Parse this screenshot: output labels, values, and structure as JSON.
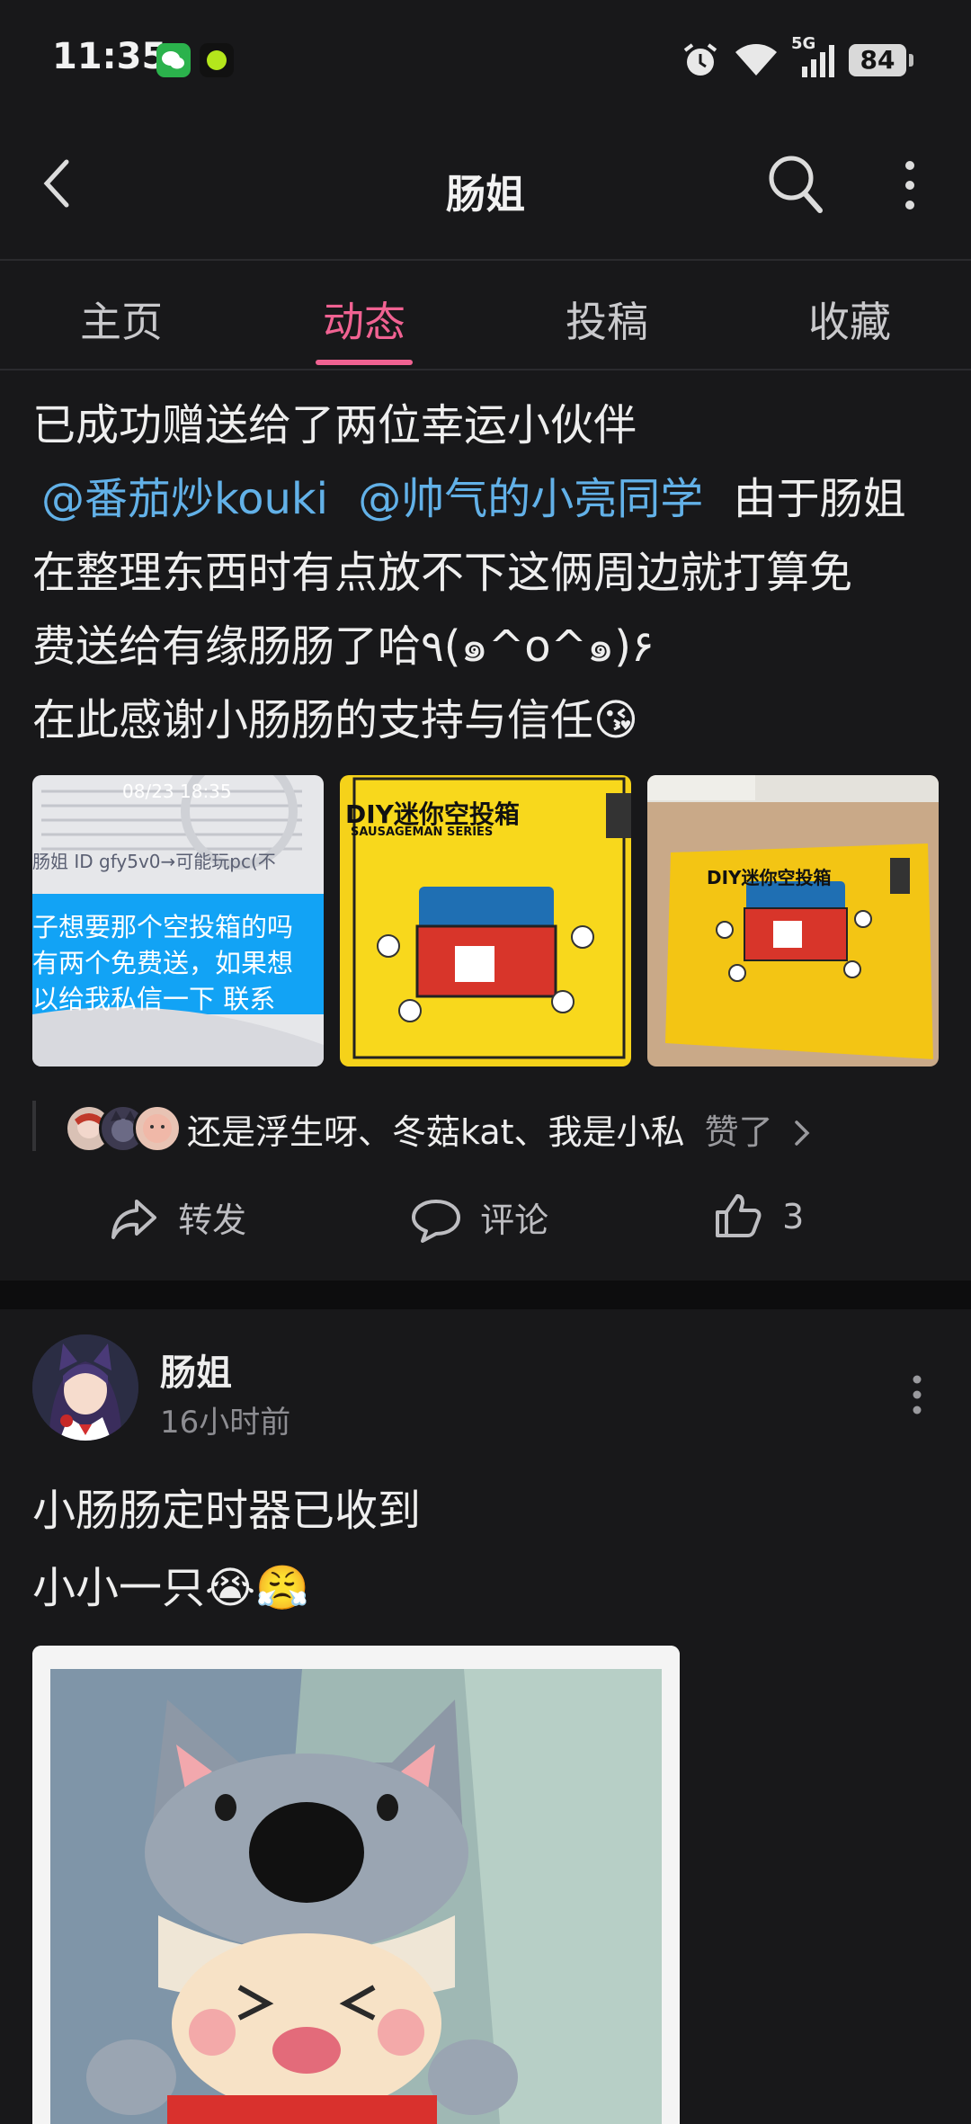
{
  "status_bar": {
    "time": "11:35",
    "signal_label": "5G",
    "battery": "84"
  },
  "header": {
    "title": "肠姐",
    "back_icon": "chevron-left-icon",
    "search_icon": "search-icon",
    "more_icon": "more-vertical-icon"
  },
  "tabs": [
    {
      "label": "主页"
    },
    {
      "label": "动态",
      "active": true
    },
    {
      "label": "投稿"
    },
    {
      "label": "收藏"
    }
  ],
  "post1": {
    "line1": "已成功赠送给了两位幸运小伙伴",
    "mention1": "@番茄炒kouki",
    "mention2": "@帅气的小亮同学",
    "line2_rest": "由于肠姐",
    "line3": "在整理东西时有点放不下这俩周边就打算免",
    "line4": "费送给有缘肠肠了哈٩(๑^o^๑)۶",
    "line5": "在此感谢小肠肠的支持与信任😘",
    "images": {
      "img1_timestamp": "08/23 18:35",
      "img1_line0": "肠姐 ID gfy5v0→可能玩pc(不",
      "img1_line1": "子想要那个空投箱的吗",
      "img1_line2": "有两个免费送，如果想",
      "img1_line3": "以给我私信一下 联系",
      "box_title": "DIY迷你空投箱",
      "box_series": "SAUSAGEMAN SERIES"
    },
    "likes_users": "还是浮生呀、冬菇kat、我是小私",
    "likes_suffix": "赞了",
    "actions": {
      "share": "转发",
      "comment": "评论",
      "like_count": "3"
    }
  },
  "post2": {
    "author": "肠姐",
    "time": "16小时前",
    "title": "小肠肠定时器已收到",
    "subtitle": "小小一只😭😤"
  }
}
